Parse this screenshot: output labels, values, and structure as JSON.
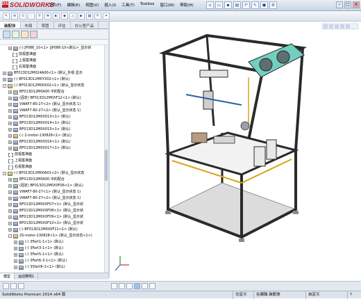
{
  "app": {
    "logo_text": "SOLIDWORKS",
    "logo_mark": "DS"
  },
  "menu": [
    "文件(F)",
    "编辑(E)",
    "视图(V)",
    "插入(I)",
    "工具(T)",
    "Toolbox",
    "窗口(W)",
    "帮助(H)"
  ],
  "panel_tabs": [
    "装配体",
    "布局",
    "草图",
    "评估",
    "办公室产品"
  ],
  "tree_rows": [
    {
      "text": "(-) JP086_10<1> (JP086-10<默认>_显示状",
      "icon": "part",
      "exp": "+"
    },
    {
      "text": "前视基准面",
      "icon": "plane",
      "exp": ""
    },
    {
      "text": "上视基准面",
      "icon": "plane",
      "exp": ""
    },
    {
      "text": "右视基准面",
      "icon": "plane",
      "exp": ""
    },
    {
      "text": "BF013D12M024A00<1> (默认_外观 显示",
      "icon": "part",
      "exp": "+"
    },
    {
      "text": "(-) BF013D12M0YX02<1> (默认)",
      "icon": "part",
      "exp": "+"
    },
    {
      "text": "(-) BF013D12M00X02<1> (默认_显示状态",
      "icon": "asm",
      "exp": "-"
    },
    {
      "text": "BF013D12M0A00 中的配合",
      "icon": "mate",
      "exp": "+"
    },
    {
      "text": "(固定) BF013D12M0XF12<1> (默认)",
      "icon": "part",
      "exp": "+"
    },
    {
      "text": "VWAF7-80-27<2> (默认_显示状态 1)",
      "icon": "part",
      "exp": "+"
    },
    {
      "text": "VWAF7-80-27<2> (默认_显示状态 1)",
      "icon": "part",
      "exp": "+"
    },
    {
      "text": "BF013D12M0X013<1> (默认)",
      "icon": "part",
      "exp": "+"
    },
    {
      "text": "BF013D12M0X014<1> (默认)",
      "icon": "part",
      "exp": "+"
    },
    {
      "text": "BF013D12M0X015<1> (默认)",
      "icon": "part",
      "exp": "+"
    },
    {
      "text": "(-) 2-motor-130828<1> (默认)",
      "icon": "asm",
      "exp": "+"
    },
    {
      "text": "BF013D12M0X016<1> (默认)",
      "icon": "part",
      "exp": "+"
    },
    {
      "text": "BF013D12M0X017<1> (默认)",
      "icon": "part",
      "exp": "+"
    },
    {
      "text": "前视基准面",
      "icon": "plane",
      "exp": ""
    },
    {
      "text": "上视基准面",
      "icon": "plane",
      "exp": ""
    },
    {
      "text": "右视基准面",
      "icon": "plane",
      "exp": ""
    },
    {
      "text": "(-) BF013D12M00A01<2> (默认_显示状态",
      "icon": "asm",
      "exp": "-"
    },
    {
      "text": "BF013D12M0A00 中的配合",
      "icon": "mate",
      "exp": "+"
    },
    {
      "text": "(固定) BF013D12M0X0F06<1> (默认)",
      "icon": "part",
      "exp": "+"
    },
    {
      "text": "VWAF7-80-27<1> (默认_显示状态 1)",
      "icon": "part",
      "exp": "+"
    },
    {
      "text": "VWAF7-80-27<2> (默认_显示状态 1)",
      "icon": "part",
      "exp": "+"
    },
    {
      "text": "BF013D12M0X0F07<1> (默认_显示状",
      "icon": "part",
      "exp": "+"
    },
    {
      "text": "BF013D12M0X0F08<1> (默认_显示状",
      "icon": "part",
      "exp": "+"
    },
    {
      "text": "BF013D12M0X0F09<1> (默认_显示状",
      "icon": "part",
      "exp": "+"
    },
    {
      "text": "BF013D12M0X0F10<1> (默认_显示状",
      "icon": "part",
      "exp": "+"
    },
    {
      "text": "(-) BF013D12M0X0F11<1> (默认)",
      "icon": "part",
      "exp": "+"
    },
    {
      "text": "2S-motor-130828<1> (默认_显示状态<1>)",
      "icon": "asm",
      "exp": "-"
    },
    {
      "text": "(-) 3Fart1-1<1> (默认)",
      "icon": "part",
      "exp": "+"
    },
    {
      "text": "(-) 3Fart3-1<1> (默认)",
      "icon": "part",
      "exp": "+"
    },
    {
      "text": "(-) 3Fart5-1<1> (默认)",
      "icon": "part",
      "exp": "+"
    },
    {
      "text": "(-) 3Fart6-3-1<1> (默认)",
      "icon": "part",
      "exp": "+"
    },
    {
      "text": "(-) 3Sfart6-1<1> (默认)",
      "icon": "part",
      "exp": "+"
    }
  ],
  "bottom_tabs": [
    "模型",
    "运动算例1"
  ],
  "status": {
    "app": "SolidWorks Premium 2014 x64 版",
    "cells": [
      "欠定义",
      "在编辑 装配体",
      "自定义",
      "?"
    ]
  },
  "colors": {
    "frame": "#2a2a2a",
    "accent": "#d9a216",
    "panel": "#72cfc0",
    "plate": "#b89b82"
  }
}
